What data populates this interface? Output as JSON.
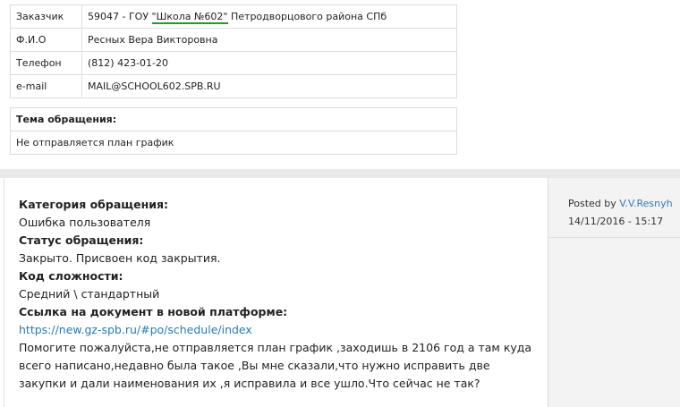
{
  "info_rows": [
    {
      "label": "Заказчик",
      "value_prefix": "59047 - ГОУ ",
      "value_highlight": "\"Школа №602\"",
      "value_suffix": " Петродворцового района СПб"
    },
    {
      "label": "Ф.И.О",
      "value": "Ресных Вера Викторовна"
    },
    {
      "label": "Телефон",
      "value": "(812) 423-01-20"
    },
    {
      "label": "e-mail",
      "value": "MAIL@SCHOOL602.SPB.RU"
    }
  ],
  "subject": {
    "header": "Тема обращения:",
    "value": "Не отправляется план график"
  },
  "message": {
    "category_label": "Категория обращения:",
    "category_value": "Ошибка пользователя",
    "status_label": "Статус обращения:",
    "status_value": "Закрыто. Присвоен код закрытия.",
    "complexity_label": "Код сложности:",
    "complexity_value": "Средний \\ стандартный",
    "link_label": "Ссылка на документ в новой платформе:",
    "link_url": "https://new.gz-spb.ru/#po/schedule/index",
    "text": "Помогите пожалуйста,не отправляется план график ,заходишь в 2106 год а там куда всего написано,недавно была такое ,Вы мне сказали,что нужно исправить две закупки и дали наименования их ,я исправила и все ушло.Что сейчас не так?"
  },
  "meta": {
    "posted_by_label": "Posted by",
    "author": "V.V.Resnyh",
    "datetime": "14/11/2016 - 15:17"
  },
  "colors": {
    "link": "#2a7ab0",
    "underline_highlight": "#1aa11a",
    "separator": "#e9e9e9",
    "meta_bg": "#f3f3f3"
  }
}
